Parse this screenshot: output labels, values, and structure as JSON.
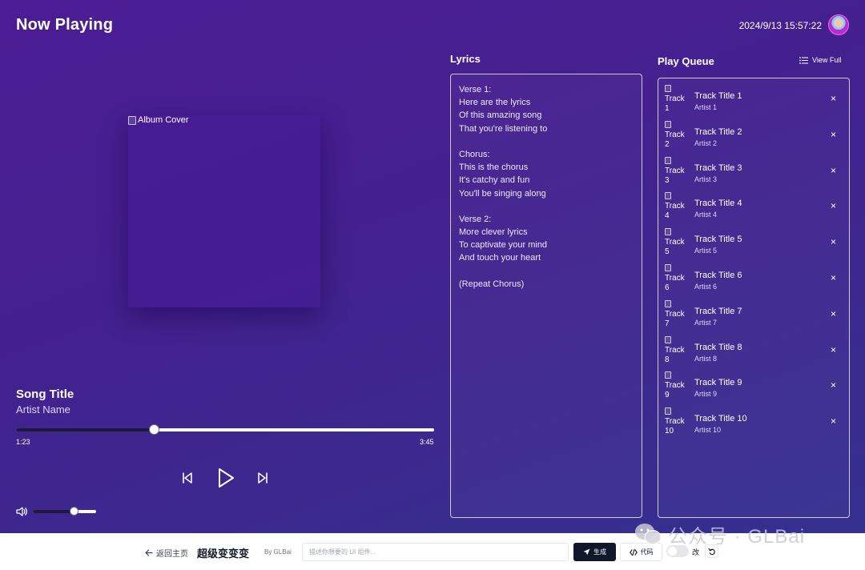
{
  "header": {
    "title": "Now Playing",
    "datetime": "2024/9/13 15:57:22"
  },
  "player": {
    "album_alt": "Album Cover",
    "song_title": "Song Title",
    "artist": "Artist Name",
    "current_time": "1:23",
    "total_time": "3:45",
    "progress": 0.33,
    "volume": 0.65
  },
  "lyrics": {
    "heading": "Lyrics",
    "lines": [
      "Verse 1:",
      "Here are the lyrics",
      "Of this amazing song",
      "That you're listening to",
      "",
      "Chorus:",
      "This is the chorus",
      "It's catchy and fun",
      "You'll be singing along",
      "",
      "Verse 2:",
      "More clever lyrics",
      "To captivate your mind",
      "And touch your heart",
      "",
      "(Repeat Chorus)"
    ]
  },
  "queue": {
    "heading": "Play Queue",
    "view_full": "View Full",
    "remove_symbol": "×",
    "items": [
      {
        "thumb_alt": "Track 1",
        "title": "Track Title 1",
        "artist": "Artist 1"
      },
      {
        "thumb_alt": "Track 2",
        "title": "Track Title 2",
        "artist": "Artist 2"
      },
      {
        "thumb_alt": "Track 3",
        "title": "Track Title 3",
        "artist": "Artist 3"
      },
      {
        "thumb_alt": "Track 4",
        "title": "Track Title 4",
        "artist": "Artist 4"
      },
      {
        "thumb_alt": "Track 5",
        "title": "Track Title 5",
        "artist": "Artist 5"
      },
      {
        "thumb_alt": "Track 6",
        "title": "Track Title 6",
        "artist": "Artist 6"
      },
      {
        "thumb_alt": "Track 7",
        "title": "Track Title 7",
        "artist": "Artist 7"
      },
      {
        "thumb_alt": "Track 8",
        "title": "Track Title 8",
        "artist": "Artist 8"
      },
      {
        "thumb_alt": "Track 9",
        "title": "Track Title 9",
        "artist": "Artist 9"
      },
      {
        "thumb_alt": "Track 10",
        "title": "Track Title 10",
        "artist": "Artist 10"
      }
    ]
  },
  "bottom_bar": {
    "back_label": "返回主页",
    "brand": "超级变变变",
    "by": "By GLBai",
    "input_placeholder": "描述你想要的 UI 组件...",
    "generate_label": "生成",
    "code_label": "代码",
    "toggle_label": "改"
  },
  "watermark": {
    "text": "公众号 · GLBai"
  },
  "icons": {
    "prev": "skip-back-icon",
    "play": "play-icon",
    "next": "skip-forward-icon",
    "volume": "volume-icon",
    "list": "list-icon",
    "back": "arrow-left-icon",
    "send": "send-icon",
    "code": "code-icon",
    "undo": "undo-icon"
  },
  "colors": {
    "accent_bg": "#4c1d95",
    "dark_button": "#0f172a"
  }
}
